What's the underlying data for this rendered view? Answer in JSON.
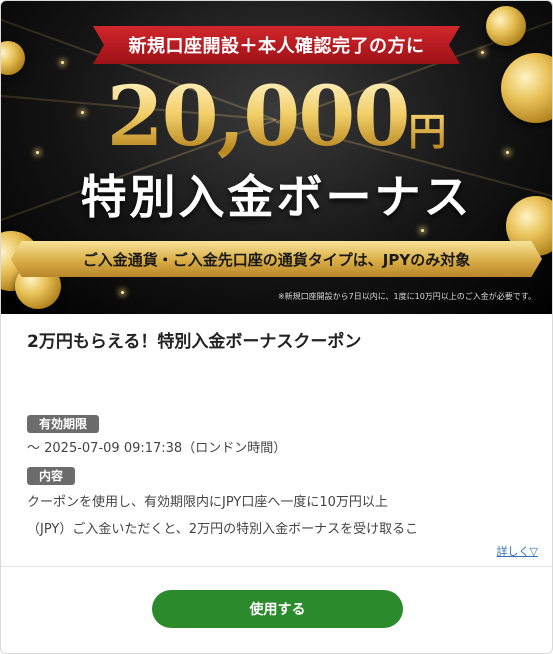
{
  "banner": {
    "ribbon_top": "新規口座開設＋本人確認完了の方に",
    "amount": "20,000",
    "amount_unit": "円",
    "headline": "特別入金ボーナス",
    "ribbon_gold": "ご入金通貨・ご入金先口座の通貨タイプは、JPYのみ対象",
    "fine_print": "※新規口座開設から7日以内に、1度に10万円以上のご入金が必要です。"
  },
  "coupon": {
    "title": "2万円もらえる！特別入金ボーナスクーポン",
    "validity_label": "有効期限",
    "validity_value": "～ 2025-07-09 09:17:38（ロンドン時間）",
    "content_label": "内容",
    "content_line1": "クーポンを使用し、有効期限内にJPY口座へ一度に10万円以上",
    "content_line2": "（JPY）ご入金いただくと、2万円の特別入金ボーナスを受け取るこ",
    "more_link": "詳しく▽",
    "use_button": "使用する"
  },
  "colors": {
    "use_button": "#2b8a2b",
    "tag_bg": "#6c6c6c",
    "link": "#2f6fb5",
    "ribbon_red": "#c41e24",
    "gold": "#e5bd5c"
  }
}
